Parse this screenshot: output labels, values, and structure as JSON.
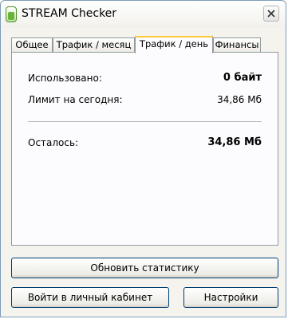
{
  "window": {
    "title": "STREAM Checker"
  },
  "tabs": [
    {
      "label": "Общее"
    },
    {
      "label": "Трафик / месяц"
    },
    {
      "label": "Трафик / день"
    },
    {
      "label": "Финансы"
    }
  ],
  "active_tab": "Трафик / день",
  "stats": {
    "used_label": "Использовано:",
    "used_value": "0 байт",
    "limit_label": "Лимит на сегодня:",
    "limit_value": "34,86 Мб",
    "remaining_label": "Осталось:",
    "remaining_value": "34,86 Мб"
  },
  "buttons": {
    "refresh": "Обновить статистику",
    "account": "Войти в личный кабинет",
    "settings": "Настройки"
  },
  "colors": {
    "active_tab_accent": "#ffc83c",
    "button_border": "#003c74"
  },
  "icons": {
    "app": "stream-app-icon",
    "close": "close-icon"
  }
}
